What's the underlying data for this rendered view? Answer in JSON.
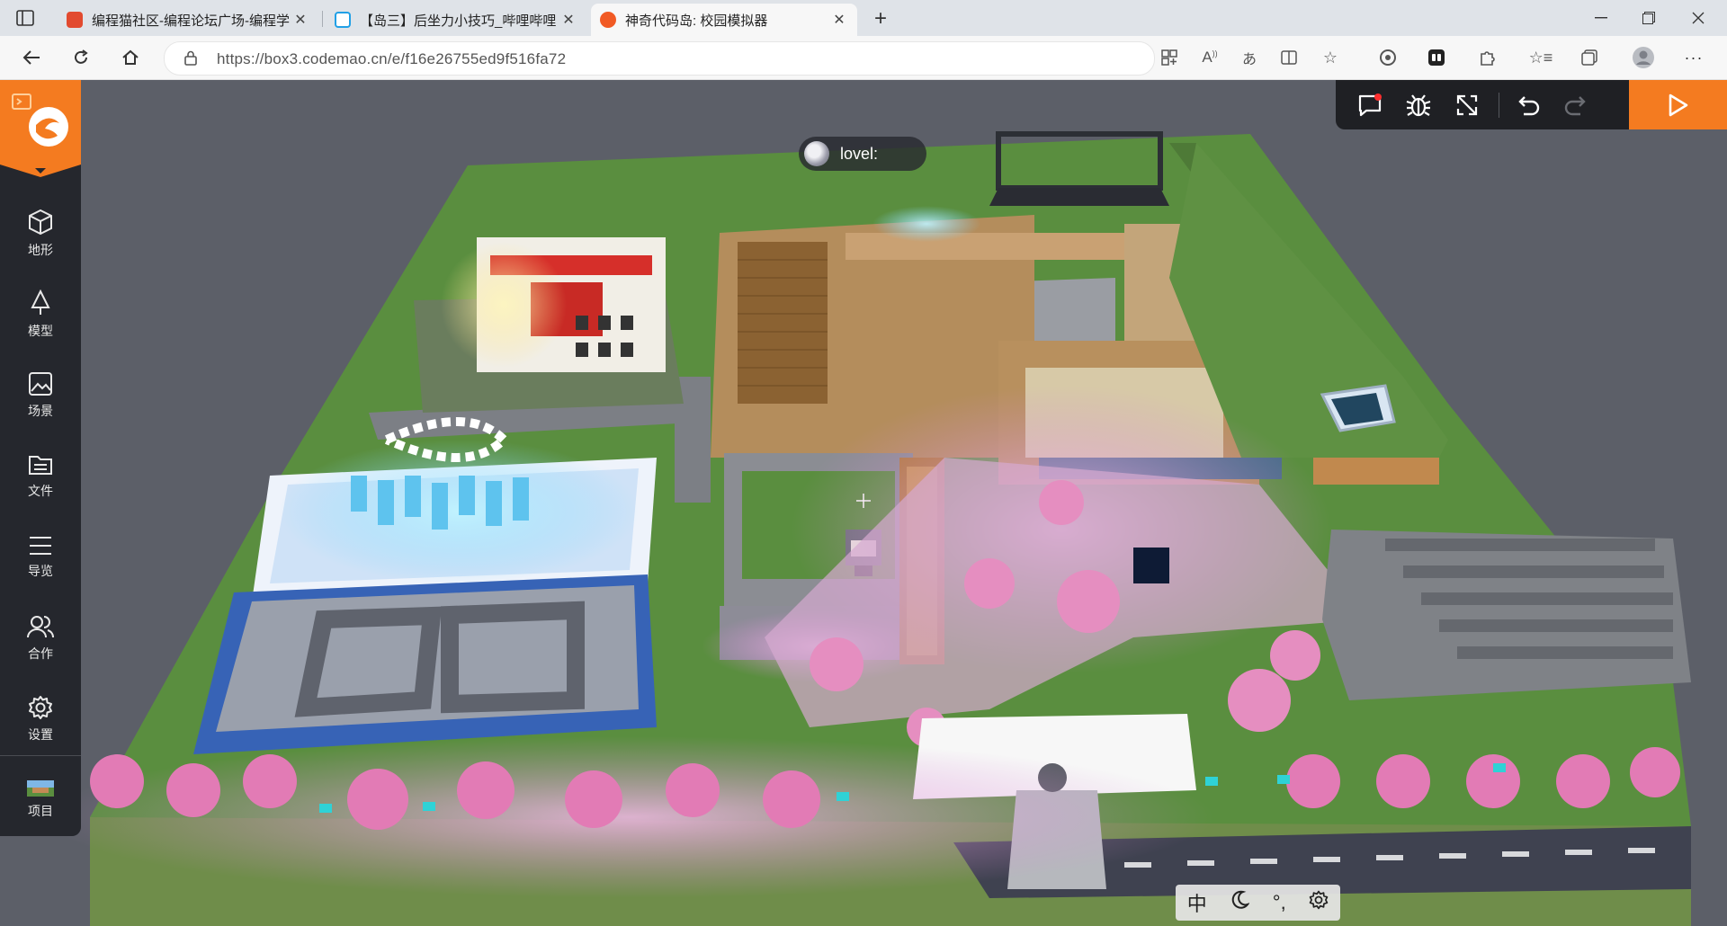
{
  "browser": {
    "tabs": [
      {
        "title": "编程猫社区-编程论坛广场-编程学",
        "favicon_color": "#e24a2f",
        "active": false
      },
      {
        "title": "【岛三】后坐力小技巧_哔哩哔哩",
        "favicon_color": "#21a0e6",
        "active": false
      },
      {
        "title": "神奇代码岛: 校园模拟器",
        "favicon_color": "#f15a24",
        "active": true
      }
    ],
    "new_tab_label": "+",
    "url": "https://box3.codemao.cn/e/f16e26755ed9f516fa72",
    "window_controls": [
      "minimize",
      "restore",
      "close"
    ]
  },
  "sidebar": {
    "items": [
      {
        "label": "地形",
        "icon": "cube-icon"
      },
      {
        "label": "模型",
        "icon": "tree-icon"
      },
      {
        "label": "场景",
        "icon": "image-icon"
      },
      {
        "label": "文件",
        "icon": "folder-icon"
      },
      {
        "label": "导览",
        "icon": "list-icon"
      },
      {
        "label": "合作",
        "icon": "users-icon"
      },
      {
        "label": "设置",
        "icon": "gear-icon"
      }
    ],
    "project_label": "项目"
  },
  "toolbar": {
    "icons": [
      "chat-icon",
      "debug-bug-icon",
      "fullscreen-icon",
      "undo-icon",
      "redo-icon"
    ],
    "play_icon": "play-icon",
    "accent": "#f47b20"
  },
  "player": {
    "name": "lovel:"
  },
  "status": {
    "lang": "中",
    "items": [
      "moon-icon",
      "punctuation-icon",
      "gear-icon"
    ]
  }
}
